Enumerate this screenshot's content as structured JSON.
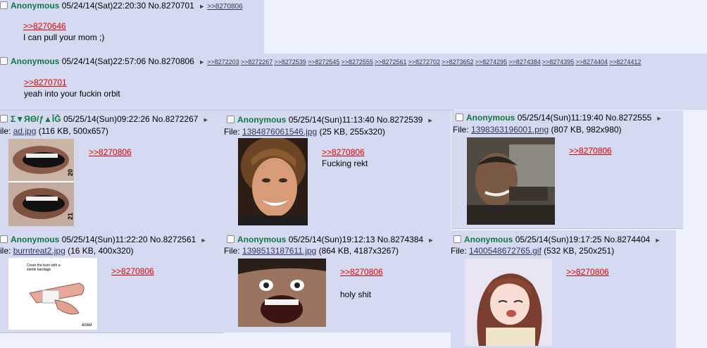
{
  "posts": [
    {
      "name": "Anonymous",
      "datetime": "05/24/14(Sat)22:20:30",
      "no": "No.8270701",
      "backlinks": [
        ">>8270806"
      ],
      "quote": ">>8270646",
      "message": "I can pull your mom ;)"
    },
    {
      "name": "Anonymous",
      "datetime": "05/24/14(Sat)22:57:06",
      "no": "No.8270806",
      "backlinks": [
        ">>8272203",
        ">>8272267",
        ">>8272539",
        ">>8272545",
        ">>8272555",
        ">>8272561",
        ">>8272702",
        ">>8273652",
        ">>8274295",
        ">>8274384",
        ">>8274395",
        ">>8274404",
        ">>8274412"
      ],
      "quote": ">>8270701",
      "message": "yeah into your fuckin orbit"
    },
    {
      "name": "Σ▼ЯΘ/ƒ▲ĬĞ",
      "datetime": "05/25/14(Sun)09:22:26",
      "no": "No.8272267",
      "file_prefix": "ile: ",
      "file_name": "ad.jpg",
      "file_info": "(116 KB, 500x657)",
      "quote": ">>8270806",
      "message": "",
      "thumb_labels": [
        "20",
        "21"
      ]
    },
    {
      "name": "Anonymous",
      "datetime": "05/25/14(Sun)11:13:40",
      "no": "No.8272539",
      "file_prefix": "File: ",
      "file_name": "1384876061546.jpg",
      "file_info": "(25 KB, 255x320)",
      "quote": ">>8270806",
      "message": "Fucking rekt"
    },
    {
      "name": "Anonymous",
      "datetime": "05/25/14(Sun)11:19:40",
      "no": "No.8272555",
      "file_prefix": "File: ",
      "file_name": "1398363196001.png",
      "file_info": "(807 KB, 982x980)",
      "quote": ">>8270806",
      "message": ""
    },
    {
      "name": "Anonymous",
      "datetime": "05/25/14(Sun)11:22:20",
      "no": "No.8272561",
      "file_prefix": "ile: ",
      "file_name": "burntreat2.jpg",
      "file_info": "(16 KB, 400x320)",
      "quote": ">>8270806",
      "message": "",
      "thumb_caption": "Cover the burn with a sterile bandage",
      "thumb_credit": "ADAM"
    },
    {
      "name": "Anonymous",
      "datetime": "05/25/14(Sun)19:12:13",
      "no": "No.8274384",
      "file_prefix": "File: ",
      "file_name": "1398513187611.jpg",
      "file_info": "(864 KB, 4187x3267)",
      "quote": ">>8270806",
      "message": "holy shit"
    },
    {
      "name": "Anonymous",
      "datetime": "05/25/14(Sun)19:17:25",
      "no": "No.8274404",
      "file_prefix": "File: ",
      "file_name": "1400548672765.gif",
      "file_info": "(532 KB, 250x251)",
      "quote": ">>8270806",
      "message": ""
    }
  ],
  "colors": {
    "background": "#eef2ff",
    "post_bg": "#d6daf0",
    "name": "#117743",
    "quotelink": "#dd0000",
    "link": "#34345c"
  },
  "icons": {
    "checkbox": "checkbox-icon",
    "arrow": "arrow-right-icon"
  }
}
